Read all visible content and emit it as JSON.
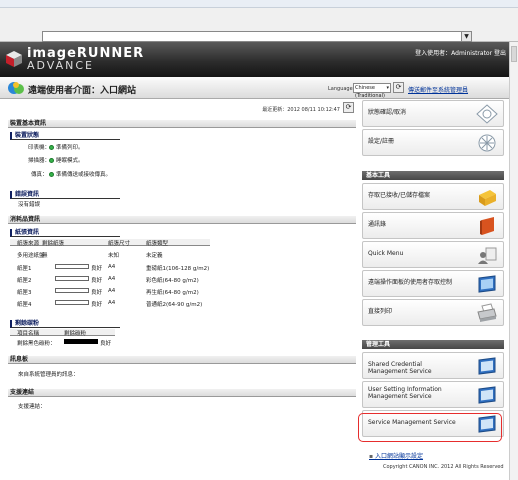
{
  "header": {
    "brand_line1": "imageRUNNER",
    "brand_line2": "ADVANCE",
    "user_text": "登入使用者：Administrator",
    "logout": "登出"
  },
  "subheader": {
    "title": "遠端使用者介面：入口網站",
    "language_label": "Language:",
    "language_value": "Chinese (Traditional)",
    "mail_link": "傳送郵件至系統管理員"
  },
  "main": {
    "last_updated": "最近更新：2012 08/11 10:12:47",
    "device_info": {
      "section": "裝置基本資訊",
      "status_title": "裝置狀態",
      "rows": [
        {
          "label": "印表機：",
          "status": "準備列印。"
        },
        {
          "label": "掃描器：",
          "status": "睡眠模式。"
        },
        {
          "label": "傳真：",
          "status": "準備傳送或接收傳真。"
        }
      ],
      "error_title": "錯誤資訊",
      "error_text": "沒有錯誤"
    },
    "consumables": {
      "section": "消耗品資訊",
      "paper_title": "紙張資訊",
      "headers": [
        "紙張來源",
        "剩餘紙張",
        "紙張尺寸",
        "紙張類型"
      ],
      "rows": [
        {
          "source": "多用途紙盤",
          "remaining": "無",
          "size": "未知",
          "type": "未定義",
          "bar": false
        },
        {
          "source": "紙匣1",
          "remaining": "良好",
          "size": "A4",
          "type": "重磅紙1(106-128 g/m2)",
          "bar": true
        },
        {
          "source": "紙匣2",
          "remaining": "良好",
          "size": "A4",
          "type": "彩色紙(64-80 g/m2)",
          "bar": true
        },
        {
          "source": "紙匣3",
          "remaining": "良好",
          "size": "A4",
          "type": "再生紙(64-80 g/m2)",
          "bar": true
        },
        {
          "source": "紙匣4",
          "remaining": "良好",
          "size": "A4",
          "type": "普通紙2(64-90 g/m2)",
          "bar": true
        }
      ],
      "toner_title": "剩餘碳粉",
      "toner_headers": [
        "項目名稱",
        "剩餘碳粉"
      ],
      "toner_row": {
        "name": "剩餘黑色碳粉：",
        "value": "良好"
      }
    },
    "message": {
      "section": "訊息板",
      "text": "來自系統管理員的訊息："
    },
    "support": {
      "section": "支援連結",
      "text": "支援連結："
    }
  },
  "sidebar": {
    "top_items": [
      {
        "label": "狀態確認/取消"
      },
      {
        "label": "設定/註冊"
      }
    ],
    "basic_tools_title": "基本工具",
    "basic_tools": [
      {
        "label": "存取已接收/已儲存檔案"
      },
      {
        "label": "通訊錄"
      },
      {
        "label": "Quick Menu"
      },
      {
        "label": "遠端操作面板的使用者存取控制"
      },
      {
        "label": "直接列印"
      }
    ],
    "admin_tools_title": "管理工具",
    "admin_tools": [
      {
        "label": "Shared Credential Management Service"
      },
      {
        "label": "User Setting Information Management Service"
      },
      {
        "label": "Service Management Service"
      }
    ],
    "portal_link": "入口網站顯示設定",
    "copyright": "Copyright CANON INC. 2012 All Rights Reserved"
  }
}
